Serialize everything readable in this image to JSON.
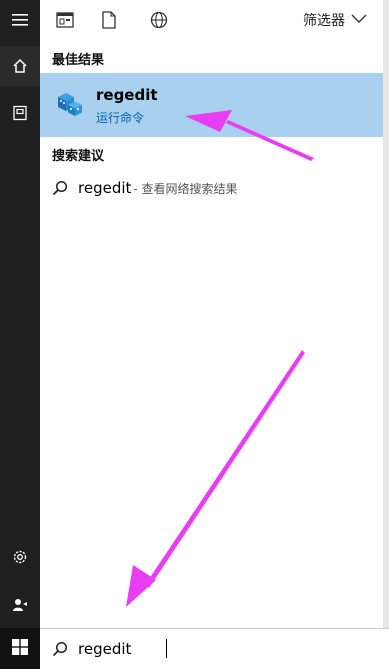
{
  "topbar": {
    "filter_label": "筛选器"
  },
  "best_result": {
    "heading": "最佳结果",
    "name": "regedit",
    "subtitle": "运行命令"
  },
  "suggestions": {
    "heading": "搜索建议",
    "items": [
      {
        "term": "regedit",
        "hint": " - 查看网络搜索结果"
      }
    ]
  },
  "search": {
    "value": "regedit"
  },
  "colors": {
    "selection": "#a9d1ef",
    "sidebar": "#1f1f1f",
    "annotation_arrow": "#e83df2",
    "link_blue": "#0063b1"
  },
  "icons": {
    "sidebar": [
      "hamburger-menu-icon",
      "home-icon",
      "document-icon",
      "settings-gear-icon",
      "user-account-icon"
    ],
    "topbar": [
      "apps-icon",
      "documents-icon",
      "web-globe-icon",
      "chevron-down-icon"
    ],
    "results": [
      "registry-editor-app-icon",
      "search-magnifier-icon"
    ],
    "taskbar": [
      "windows-logo-icon"
    ]
  }
}
